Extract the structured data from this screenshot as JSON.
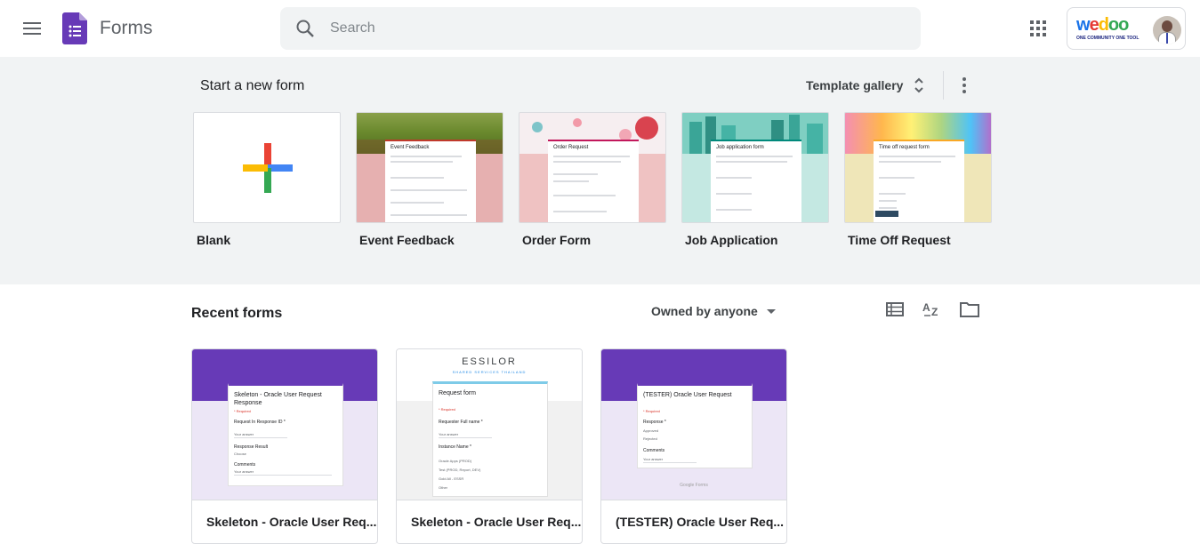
{
  "header": {
    "app_title": "Forms",
    "search_placeholder": "Search",
    "account_brand": "wedoo",
    "account_tagline": "ONE COMMUNITY ONE TOOL"
  },
  "templates": {
    "section_title": "Start a new form",
    "gallery_label": "Template gallery",
    "items": [
      {
        "label": "Blank"
      },
      {
        "label": "Event Feedback",
        "card_title": "Event Feedback"
      },
      {
        "label": "Order Form",
        "card_title": "Order Request"
      },
      {
        "label": "Job Application",
        "card_title": "Job application form"
      },
      {
        "label": "Time Off Request",
        "card_title": "Time off request form"
      }
    ]
  },
  "recent": {
    "section_title": "Recent forms",
    "owner_filter": "Owned by anyone",
    "items": [
      {
        "title": "Skeleton - Oracle User Req...",
        "form_title": "Skeleton - Oracle User Request Response",
        "required": "* Required",
        "q1": "Request In Response ID *",
        "q2": "Response Result",
        "q2_value": "Choose",
        "q3": "Comments",
        "placeholder": "Your answer"
      },
      {
        "title": "Skeleton - Oracle User Req...",
        "banner_brand": "ESSILOR",
        "banner_sub": "SHARED SERVICES THAILAND",
        "form_title": "Request form",
        "required": "* Required",
        "q1": "Requester Full name *",
        "q2": "Instance Name *",
        "options": [
          "Oracle Apps (PROD)",
          "Test (PROD, Report, DEV)",
          "Gold All - ESSR",
          "Other"
        ],
        "placeholder": "Your answer"
      },
      {
        "title": "(TESTER) Oracle User Req...",
        "form_title": "(TESTER) Oracle User Request",
        "required": "* Required",
        "q1": "Response *",
        "options": [
          "Approved",
          "Rejected"
        ],
        "q2": "Comments",
        "placeholder": "Your answer",
        "footer": "Google Forms"
      }
    ]
  },
  "colors": {
    "forms_purple": "#673ab7",
    "background_grey": "#f1f3f4",
    "text_primary": "#202124",
    "text_secondary": "#5f6368"
  },
  "icons": [
    "menu-icon",
    "forms-logo-icon",
    "search-icon",
    "apps-icon",
    "unfold-icon",
    "more-vert-icon",
    "list-view-icon",
    "sort-az-icon",
    "folder-icon",
    "caret-down-icon",
    "plus-icon"
  ]
}
